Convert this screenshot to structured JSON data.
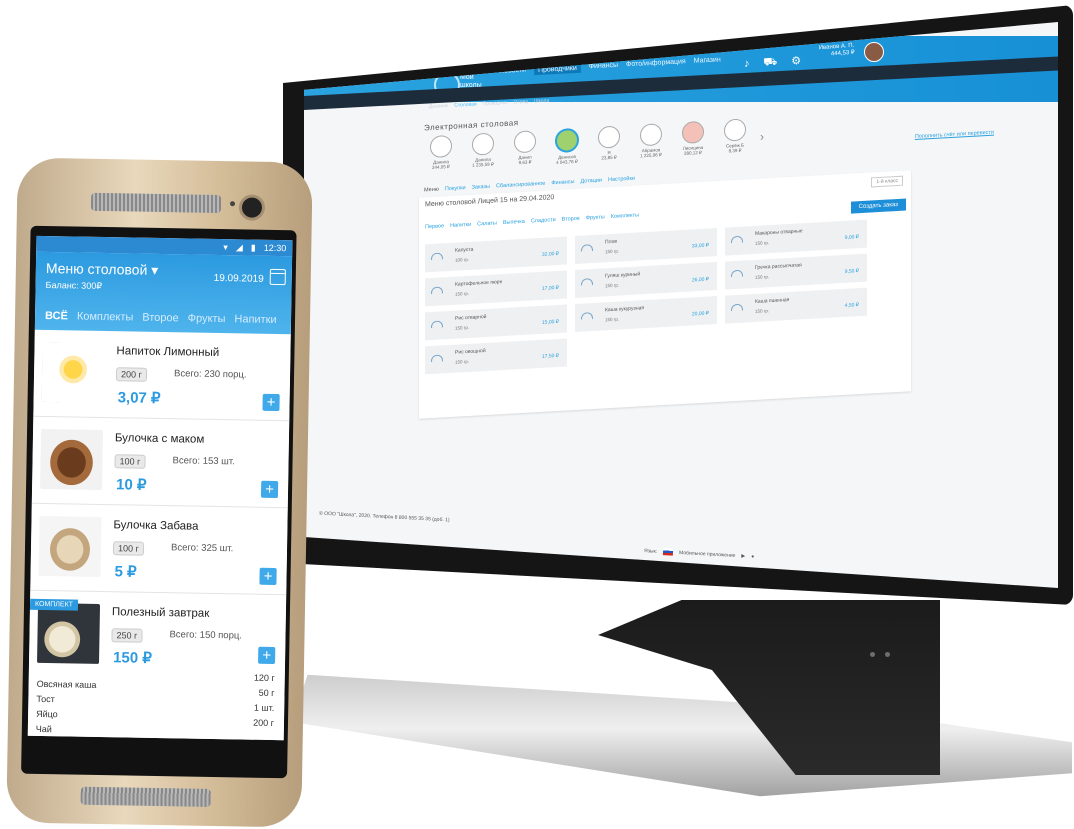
{
  "desktop": {
    "logo_text": "Мои школы",
    "nav": [
      "Новости",
      "Проводчики",
      "Финансы",
      "Фото/информация",
      "Магазин"
    ],
    "user_name": "Иванов А. П.",
    "user_balance": "444,53 ₽",
    "subnav": [
      "Дневник",
      "Столовая",
      "Проводчик",
      "Отряд",
      "Школа"
    ],
    "section_title": "Электронная столовая",
    "people": [
      {
        "name": "Данила",
        "info": "244,05 ₽"
      },
      {
        "name": "Данила",
        "info": "1 235,59 ₽"
      },
      {
        "name": "Данил",
        "info": "9,63 ₽"
      },
      {
        "name": "Денисов",
        "info": "4 043,76 ₽"
      },
      {
        "name": "Я",
        "info": "23,85 ₽"
      },
      {
        "name": "Абрамов",
        "info": "1 225,96 ₽"
      },
      {
        "name": "Лисицина",
        "info": "280,12 ₽"
      },
      {
        "name": "Серёж Б",
        "info": "8,39 ₽"
      }
    ],
    "topup_link": "Пополнить счёт или перевести",
    "tabs": [
      "Меню",
      "Покупки",
      "Заказы",
      "Сбалансированное",
      "Финансы",
      "Дотации",
      "Настройки"
    ],
    "menu_title": "Меню столовой Лицей 15 на 29.04.2020",
    "filter": "1-й класс",
    "categories": [
      "Первое",
      "Напитки",
      "Салаты",
      "Выпечка",
      "Сладости",
      "Второе",
      "Фрукты",
      "Комплекты"
    ],
    "order_button": "Создать заказ",
    "items": [
      {
        "name": "Капуста",
        "weight": "100 гр.",
        "price": "32,00 ₽"
      },
      {
        "name": "Плов",
        "weight": "150 гр.",
        "price": "33,00 ₽"
      },
      {
        "name": "Макароны отварные",
        "weight": "150 гр.",
        "price": "9,00 ₽"
      },
      {
        "name": "Картофельное пюре",
        "weight": "150 гр.",
        "price": "17,00 ₽"
      },
      {
        "name": "Гуляш куриный",
        "weight": "150 гр.",
        "price": "26,00 ₽"
      },
      {
        "name": "Гречка рассыпчатая",
        "weight": "150 гр.",
        "price": "9,50 ₽"
      },
      {
        "name": "Рис отварной",
        "weight": "150 гр.",
        "price": "15,00 ₽"
      },
      {
        "name": "Каша кукурузная",
        "weight": "150 гр.",
        "price": "20,00 ₽"
      },
      {
        "name": "Каша пшенная",
        "weight": "150 гр.",
        "price": "4,50 ₽"
      },
      {
        "name": "Рис овощной",
        "weight": "150 гр.",
        "price": "17,50 ₽"
      }
    ],
    "footer": "© ООО \"Школа\", 2020. Телефон 8 800 555 35 35 (доб. 1)",
    "language_label": "Язык:",
    "mobile_apps": "Мобильное приложение"
  },
  "phone": {
    "status_time": "12:30",
    "title": "Меню столовой",
    "balance": "Баланс: 300₽",
    "date": "19.09.2019",
    "tabs": [
      "ВСЁ",
      "Комплекты",
      "Второе",
      "Фрукты",
      "Напитки"
    ],
    "items": [
      {
        "name": "Напиток Лимонный",
        "weight": "200 г",
        "portions": "Всего: 230 порц.",
        "price": "3,07 ₽"
      },
      {
        "name": "Булочка с маком",
        "weight": "100 г",
        "portions": "Всего: 153 шт.",
        "price": "10 ₽"
      },
      {
        "name": "Булочка Забава",
        "weight": "100 г",
        "portions": "Всего: 325 шт.",
        "price": "5 ₽"
      },
      {
        "name": "Полезный завтрак",
        "weight": "250 г",
        "portions": "Всего: 150 порц.",
        "price": "150 ₽",
        "badge": "КОМПЛЕКТ"
      }
    ],
    "combo_contents": [
      {
        "name": "Овсяная каша",
        "amount": "120 г"
      },
      {
        "name": "Тост",
        "amount": "50 г"
      },
      {
        "name": "Яйцо",
        "amount": "1 шт."
      },
      {
        "name": "Чай",
        "amount": "200 г"
      }
    ]
  },
  "colors": {
    "accent": "#2c9ae0",
    "dark_bar": "#1d2c3a"
  }
}
